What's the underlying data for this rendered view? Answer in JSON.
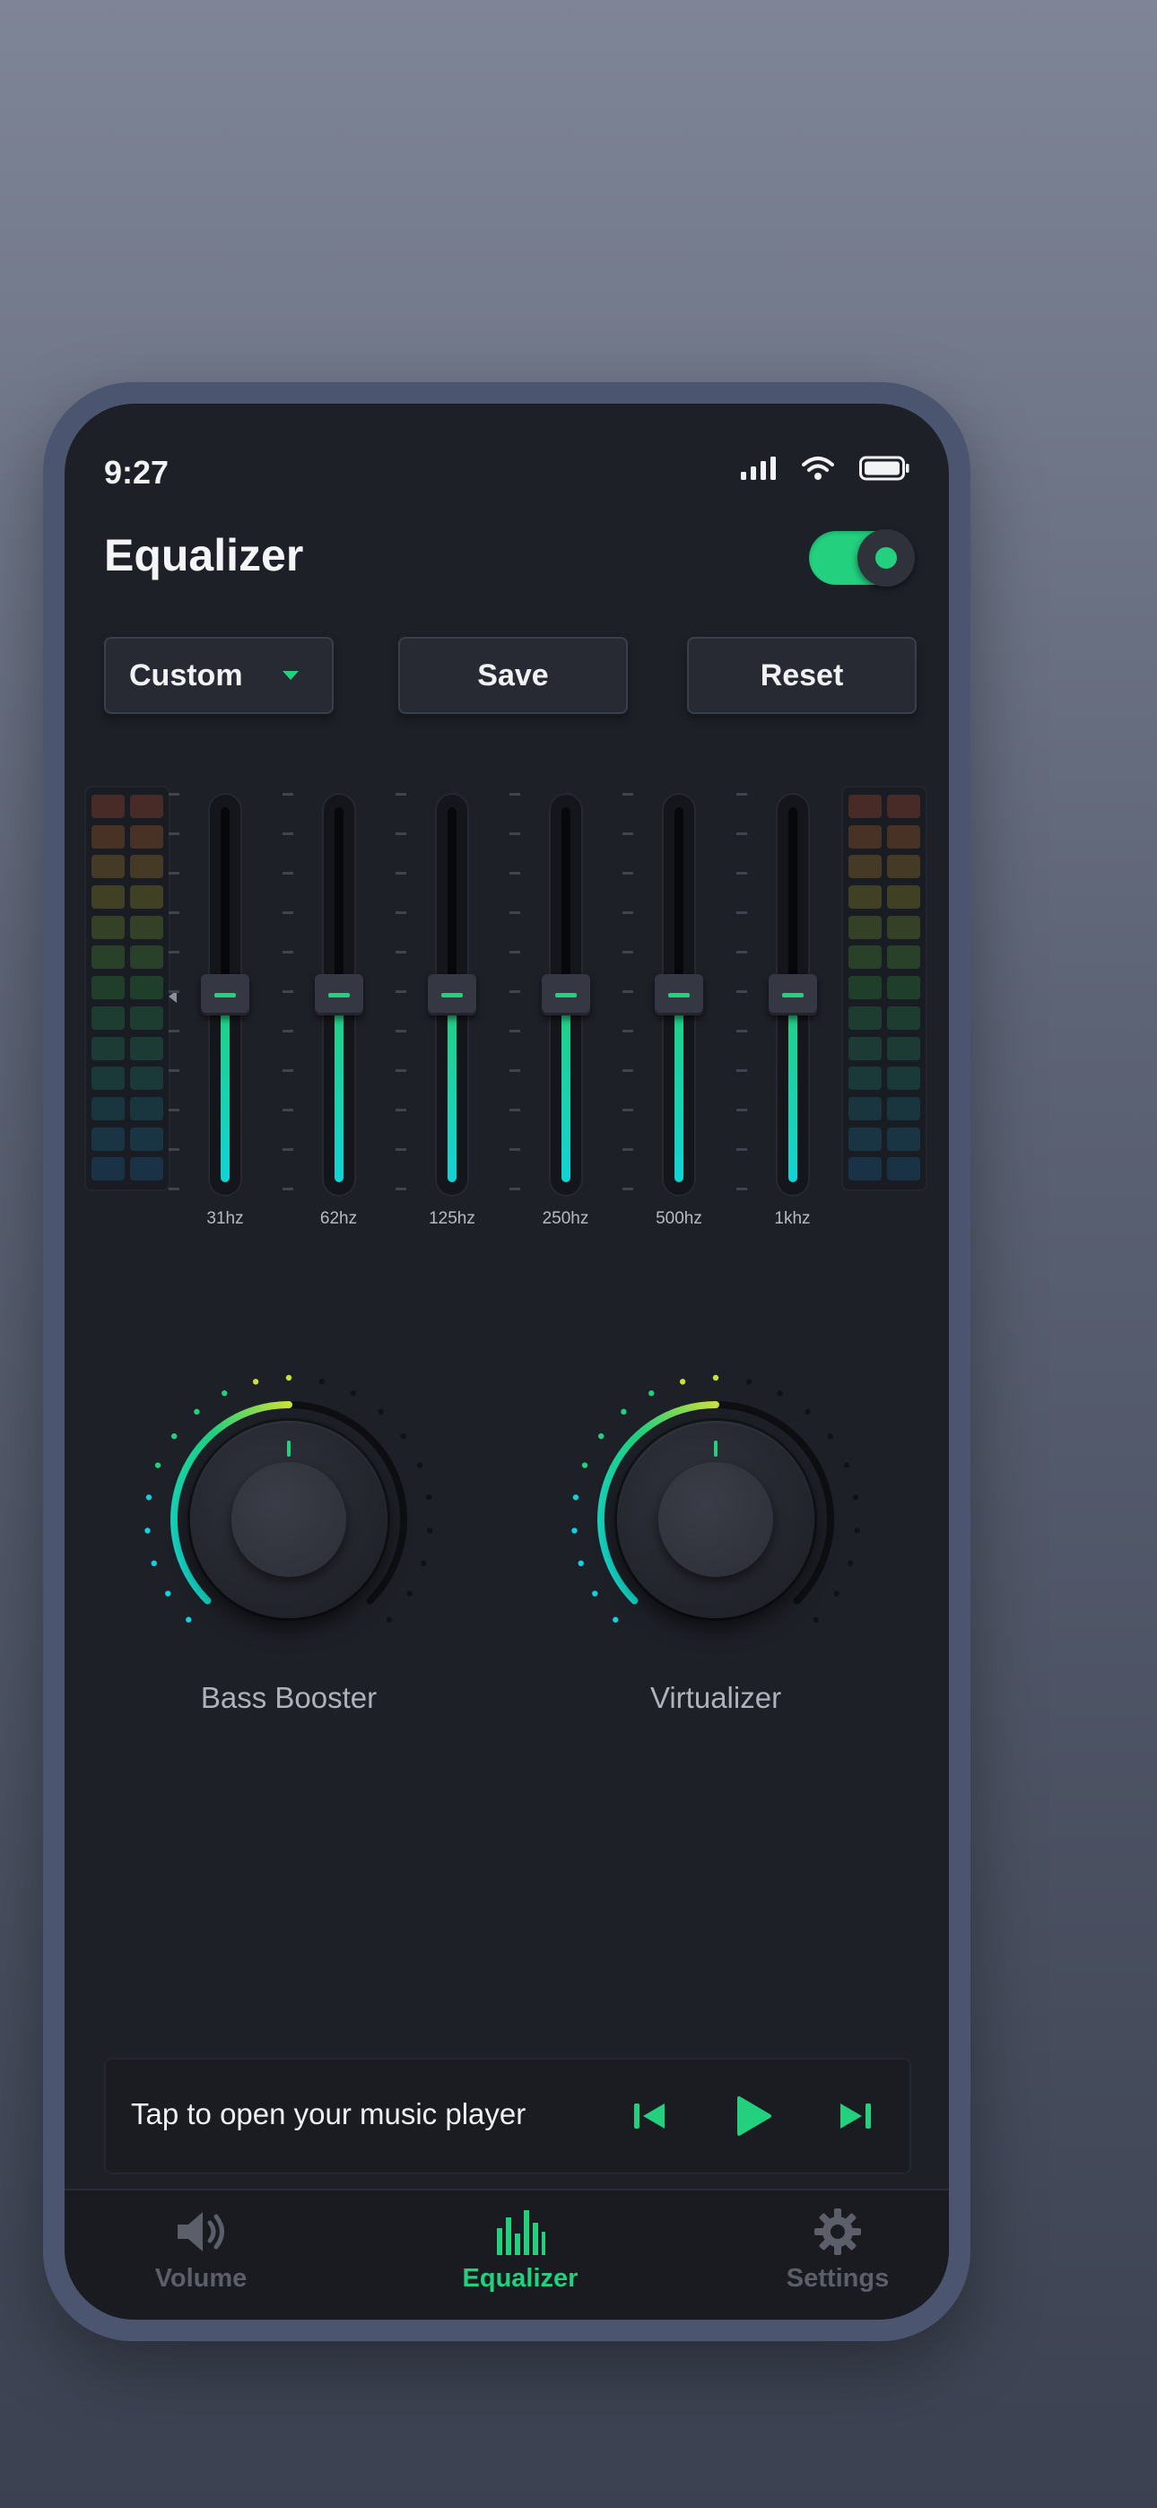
{
  "status_bar": {
    "time": "9:27",
    "icons": [
      "signal-icon",
      "wifi-icon",
      "battery-icon"
    ]
  },
  "header": {
    "title": "Equalizer",
    "power_on": true
  },
  "controls": {
    "preset_label": "Custom",
    "save_label": "Save",
    "reset_label": "Reset"
  },
  "equalizer": {
    "bands": [
      {
        "label": "31hz",
        "level": 0.5
      },
      {
        "label": "62hz",
        "level": 0.5
      },
      {
        "label": "125hz",
        "level": 0.5
      },
      {
        "label": "250hz",
        "level": 0.5
      },
      {
        "label": "500hz",
        "level": 0.5
      },
      {
        "label": "1khz",
        "level": 0.5
      }
    ]
  },
  "knobs": [
    {
      "label": "Bass Booster",
      "level": 0.5
    },
    {
      "label": "Virtualizer",
      "level": 0.5
    }
  ],
  "player": {
    "prompt": "Tap to open your music player"
  },
  "nav": {
    "items": [
      {
        "label": "Volume",
        "icon": "speaker-icon",
        "active": false
      },
      {
        "label": "Equalizer",
        "icon": "equalizer-icon",
        "active": true
      },
      {
        "label": "Settings",
        "icon": "gear-icon",
        "active": false
      }
    ]
  },
  "colors": {
    "accent": "#22d07e",
    "accent_cyan": "#12d3d6",
    "screen_bg": "#1e2028",
    "frame": "#4c5570"
  }
}
